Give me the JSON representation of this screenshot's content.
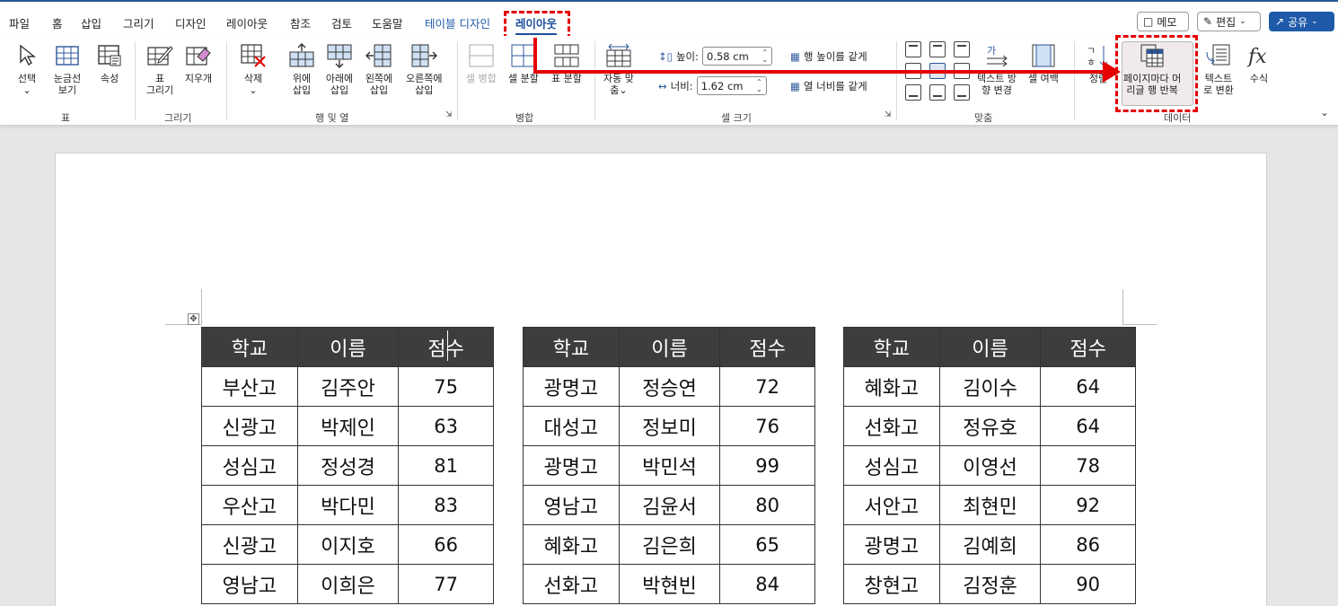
{
  "menubar": {
    "items": [
      "파일",
      "홈",
      "삽입",
      "그리기",
      "디자인",
      "레이아웃",
      "참조",
      "검토",
      "도움말",
      "테이블 디자인",
      "레이아웃"
    ],
    "memo_label": "메모",
    "edit_label": "편집",
    "share_label": "공유"
  },
  "ribbon": {
    "groups": {
      "table": "표",
      "draw": "그리기",
      "rows_cols": "행 및 열",
      "merge": "병합",
      "cell_size": "셀 크기",
      "alignment": "맞춤",
      "data": "데이터"
    },
    "buttons": {
      "select": "선택",
      "gridlines_1": "눈금선",
      "gridlines_2": "보기",
      "properties": "속성",
      "draw_table_1": "표",
      "draw_table_2": "그리기",
      "eraser": "지우개",
      "delete": "삭제",
      "insert_above_1": "위에",
      "insert_above_2": "삽입",
      "insert_below_1": "아래에",
      "insert_below_2": "삽입",
      "insert_left_1": "왼쪽에",
      "insert_left_2": "삽입",
      "insert_right_1": "오른쪽에",
      "insert_right_2": "삽입",
      "merge_cells": "셀 병합",
      "split_cells": "셀 분할",
      "split_table": "표 분할",
      "autofit_1": "자동 맞",
      "autofit_2": "춤",
      "height_label": "높이:",
      "height_value": "0.58 cm",
      "width_label": "너비:",
      "width_value": "1.62 cm",
      "distribute_rows": "행 높이를 같게",
      "distribute_cols": "열 너비를 같게",
      "text_direction_1": "텍스트 방",
      "text_direction_2": "향 변경",
      "cell_margins": "셀 여백",
      "sort": "정렬",
      "repeat_header_1": "페이지마다 머",
      "repeat_header_2": "리글 행 반복",
      "convert_text_1": "텍스트",
      "convert_text_2": "로 변환",
      "formula": "수식"
    }
  },
  "tables": [
    {
      "headers": [
        "학교",
        "이름",
        "점수"
      ],
      "rows": [
        [
          "부산고",
          "김주안",
          "75"
        ],
        [
          "신광고",
          "박제인",
          "63"
        ],
        [
          "성심고",
          "정성경",
          "81"
        ],
        [
          "우산고",
          "박다민",
          "83"
        ],
        [
          "신광고",
          "이지호",
          "66"
        ],
        [
          "영남고",
          "이희은",
          "77"
        ]
      ]
    },
    {
      "headers": [
        "학교",
        "이름",
        "점수"
      ],
      "rows": [
        [
          "광명고",
          "정승연",
          "72"
        ],
        [
          "대성고",
          "정보미",
          "76"
        ],
        [
          "광명고",
          "박민석",
          "99"
        ],
        [
          "영남고",
          "김윤서",
          "80"
        ],
        [
          "혜화고",
          "김은희",
          "65"
        ],
        [
          "선화고",
          "박현빈",
          "84"
        ]
      ]
    },
    {
      "headers": [
        "학교",
        "이름",
        "점수"
      ],
      "rows": [
        [
          "혜화고",
          "김이수",
          "64"
        ],
        [
          "선화고",
          "정유호",
          "64"
        ],
        [
          "성심고",
          "이영선",
          "78"
        ],
        [
          "서안고",
          "최현민",
          "92"
        ],
        [
          "광명고",
          "김예희",
          "86"
        ],
        [
          "창현고",
          "김정훈",
          "90"
        ]
      ]
    }
  ],
  "colors": {
    "accent": "#2b579a",
    "highlight": "#e60000",
    "header_fill": "#3d3d3d"
  }
}
